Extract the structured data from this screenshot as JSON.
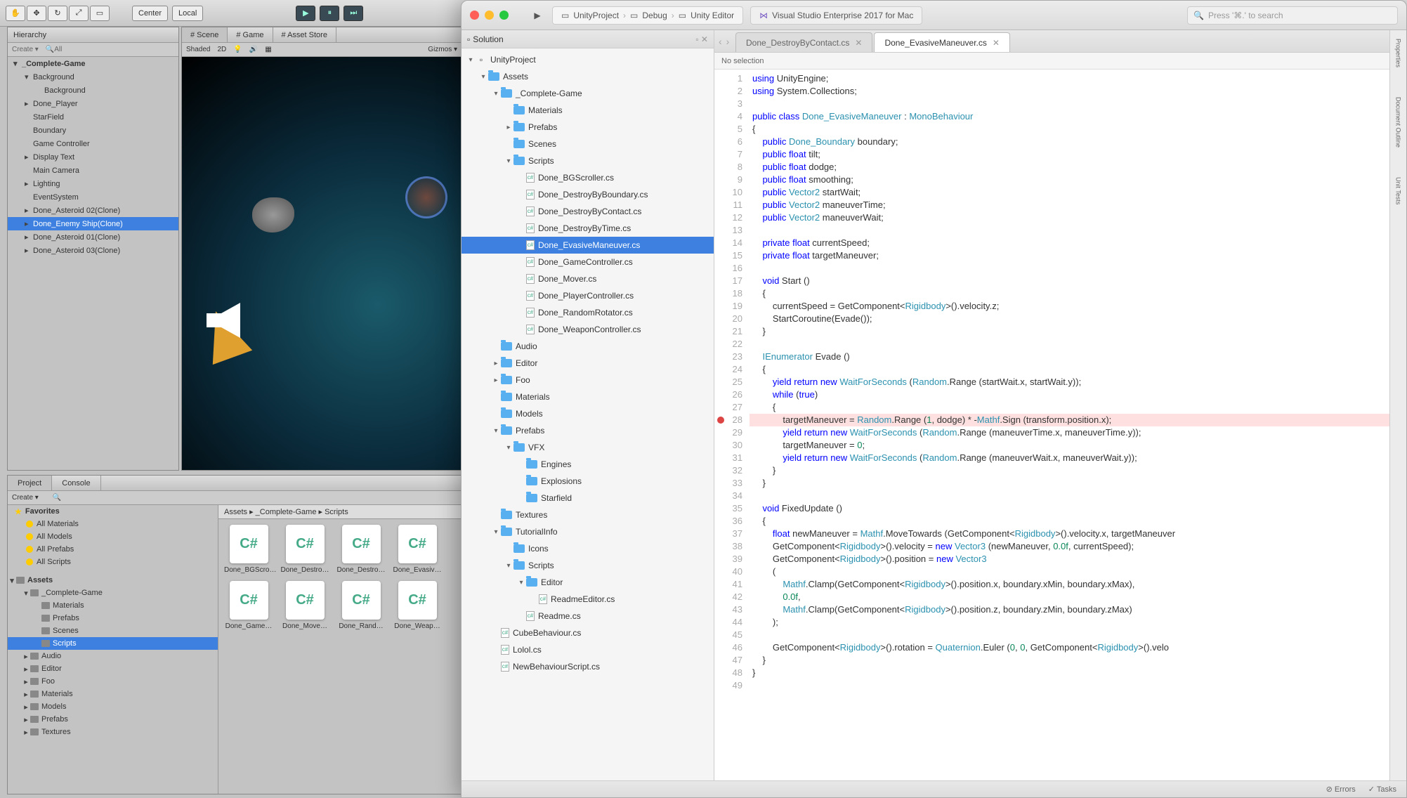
{
  "unity": {
    "toolbarButtons": [
      "✋",
      "✥",
      "↻",
      "⤢",
      "▭"
    ],
    "center": "Center",
    "local": "Local",
    "play": "▶",
    "pause": "⏸",
    "step": "⏭",
    "hierarchyTab": "Hierarchy",
    "create": "Create ▾",
    "searchAll": "All",
    "hierarchy": [
      {
        "label": "_Complete-Game",
        "indent": 0,
        "arrow": "▾",
        "bold": true
      },
      {
        "label": "Background",
        "indent": 1,
        "arrow": "▾"
      },
      {
        "label": "Background",
        "indent": 2
      },
      {
        "label": "Done_Player",
        "indent": 1,
        "arrow": "▸"
      },
      {
        "label": "StarField",
        "indent": 1
      },
      {
        "label": "Boundary",
        "indent": 1
      },
      {
        "label": "Game Controller",
        "indent": 1
      },
      {
        "label": "Display Text",
        "indent": 1,
        "arrow": "▸"
      },
      {
        "label": "Main Camera",
        "indent": 1
      },
      {
        "label": "Lighting",
        "indent": 1,
        "arrow": "▸"
      },
      {
        "label": "EventSystem",
        "indent": 1
      },
      {
        "label": "Done_Asteroid 02(Clone)",
        "indent": 1,
        "arrow": "▸"
      },
      {
        "label": "Done_Enemy Ship(Clone)",
        "indent": 1,
        "arrow": "▸",
        "sel": true
      },
      {
        "label": "Done_Asteroid 01(Clone)",
        "indent": 1,
        "arrow": "▸"
      },
      {
        "label": "Done_Asteroid 03(Clone)",
        "indent": 1,
        "arrow": "▸"
      }
    ],
    "sceneTabs": [
      "Scene",
      "Game",
      "Asset Store"
    ],
    "sceneShaded": "Shaded",
    "scene2D": "2D",
    "sceneGizmos": "Gizmos ▾",
    "projectTab": "Project",
    "consoleTab": "Console",
    "projCreate": "Create ▾",
    "breadcrumb": "Assets ▸ _Complete-Game ▸ Scripts",
    "favorites": {
      "label": "Favorites",
      "items": [
        "All Materials",
        "All Models",
        "All Prefabs",
        "All Scripts"
      ]
    },
    "assetsLabel": "Assets",
    "assetsTree": [
      {
        "label": "_Complete-Game",
        "indent": 1,
        "arrow": "▾"
      },
      {
        "label": "Materials",
        "indent": 2
      },
      {
        "label": "Prefabs",
        "indent": 2
      },
      {
        "label": "Scenes",
        "indent": 2
      },
      {
        "label": "Scripts",
        "indent": 2,
        "sel": true
      },
      {
        "label": "Audio",
        "indent": 1,
        "arrow": "▸"
      },
      {
        "label": "Editor",
        "indent": 1,
        "arrow": "▸"
      },
      {
        "label": "Foo",
        "indent": 1,
        "arrow": "▸"
      },
      {
        "label": "Materials",
        "indent": 1,
        "arrow": "▸"
      },
      {
        "label": "Models",
        "indent": 1,
        "arrow": "▸"
      },
      {
        "label": "Prefabs",
        "indent": 1,
        "arrow": "▸"
      },
      {
        "label": "Textures",
        "indent": 1,
        "arrow": "▸"
      }
    ],
    "gridFiles": [
      "Done_BGScro…",
      "Done_Destro…",
      "Done_Destro…",
      "Done_Evasiv…",
      "Done_Game…",
      "Done_Move…",
      "Done_Rand…",
      "Done_Weap…"
    ]
  },
  "vs": {
    "projectCrumb": {
      "project": "UnityProject",
      "config": "Debug",
      "target": "Unity Editor"
    },
    "appLabel": "Visual Studio Enterprise 2017 for Mac",
    "searchPlaceholder": "Press '⌘.' to search",
    "solutionTitle": "Solution",
    "solutionTree": [
      {
        "label": "UnityProject",
        "indent": 0,
        "arrow": "▾",
        "ico": "sol"
      },
      {
        "label": "Assets",
        "indent": 1,
        "arrow": "▾",
        "ico": "folder"
      },
      {
        "label": "_Complete-Game",
        "indent": 2,
        "arrow": "▾",
        "ico": "folder"
      },
      {
        "label": "Materials",
        "indent": 3,
        "ico": "folder"
      },
      {
        "label": "Prefabs",
        "indent": 3,
        "arrow": "▸",
        "ico": "folder"
      },
      {
        "label": "Scenes",
        "indent": 3,
        "ico": "folder"
      },
      {
        "label": "Scripts",
        "indent": 3,
        "arrow": "▾",
        "ico": "folder"
      },
      {
        "label": "Done_BGScroller.cs",
        "indent": 4,
        "ico": "cs"
      },
      {
        "label": "Done_DestroyByBoundary.cs",
        "indent": 4,
        "ico": "cs"
      },
      {
        "label": "Done_DestroyByContact.cs",
        "indent": 4,
        "ico": "cs"
      },
      {
        "label": "Done_DestroyByTime.cs",
        "indent": 4,
        "ico": "cs"
      },
      {
        "label": "Done_EvasiveManeuver.cs",
        "indent": 4,
        "ico": "cs",
        "sel": true
      },
      {
        "label": "Done_GameController.cs",
        "indent": 4,
        "ico": "cs"
      },
      {
        "label": "Done_Mover.cs",
        "indent": 4,
        "ico": "cs"
      },
      {
        "label": "Done_PlayerController.cs",
        "indent": 4,
        "ico": "cs"
      },
      {
        "label": "Done_RandomRotator.cs",
        "indent": 4,
        "ico": "cs"
      },
      {
        "label": "Done_WeaponController.cs",
        "indent": 4,
        "ico": "cs"
      },
      {
        "label": "Audio",
        "indent": 2,
        "ico": "folder"
      },
      {
        "label": "Editor",
        "indent": 2,
        "arrow": "▸",
        "ico": "folder"
      },
      {
        "label": "Foo",
        "indent": 2,
        "arrow": "▸",
        "ico": "folder"
      },
      {
        "label": "Materials",
        "indent": 2,
        "ico": "folder"
      },
      {
        "label": "Models",
        "indent": 2,
        "ico": "folder"
      },
      {
        "label": "Prefabs",
        "indent": 2,
        "arrow": "▾",
        "ico": "folder"
      },
      {
        "label": "VFX",
        "indent": 3,
        "arrow": "▾",
        "ico": "folder"
      },
      {
        "label": "Engines",
        "indent": 4,
        "ico": "folder"
      },
      {
        "label": "Explosions",
        "indent": 4,
        "ico": "folder"
      },
      {
        "label": "Starfield",
        "indent": 4,
        "ico": "folder"
      },
      {
        "label": "Textures",
        "indent": 2,
        "ico": "folder"
      },
      {
        "label": "TutorialInfo",
        "indent": 2,
        "arrow": "▾",
        "ico": "folder"
      },
      {
        "label": "Icons",
        "indent": 3,
        "ico": "folder"
      },
      {
        "label": "Scripts",
        "indent": 3,
        "arrow": "▾",
        "ico": "folder"
      },
      {
        "label": "Editor",
        "indent": 4,
        "arrow": "▾",
        "ico": "folder"
      },
      {
        "label": "ReadmeEditor.cs",
        "indent": 5,
        "ico": "cs"
      },
      {
        "label": "Readme.cs",
        "indent": 4,
        "ico": "cs"
      },
      {
        "label": "CubeBehaviour.cs",
        "indent": 2,
        "ico": "cs"
      },
      {
        "label": "Lolol.cs",
        "indent": 2,
        "ico": "cs"
      },
      {
        "label": "NewBehaviourScript.cs",
        "indent": 2,
        "ico": "cs"
      }
    ],
    "openTabs": [
      {
        "label": "Done_DestroyByContact.cs",
        "active": false
      },
      {
        "label": "Done_EvasiveManeuver.cs",
        "active": true
      }
    ],
    "subBar": "No selection",
    "rightRail": [
      "Properties",
      "Document Outline",
      "Unit Tests"
    ],
    "statusErrors": "Errors",
    "statusTasks": "Tasks",
    "code": [
      {
        "n": 1,
        "html": "<span class='kw'>using</span> UnityEngine;"
      },
      {
        "n": 2,
        "html": "<span class='kw'>using</span> System.Collections;"
      },
      {
        "n": 3,
        "html": ""
      },
      {
        "n": 4,
        "html": "<span class='kw'>public class</span> <span class='type'>Done_EvasiveManeuver</span> : <span class='type'>MonoBehaviour</span>"
      },
      {
        "n": 5,
        "html": "{"
      },
      {
        "n": 6,
        "html": "    <span class='kw'>public</span> <span class='type'>Done_Boundary</span> boundary;"
      },
      {
        "n": 7,
        "html": "    <span class='kw'>public</span> <span class='kw'>float</span> tilt;"
      },
      {
        "n": 8,
        "html": "    <span class='kw'>public</span> <span class='kw'>float</span> dodge;"
      },
      {
        "n": 9,
        "html": "    <span class='kw'>public</span> <span class='kw'>float</span> smoothing;"
      },
      {
        "n": 10,
        "html": "    <span class='kw'>public</span> <span class='type'>Vector2</span> startWait;"
      },
      {
        "n": 11,
        "html": "    <span class='kw'>public</span> <span class='type'>Vector2</span> maneuverTime;"
      },
      {
        "n": 12,
        "html": "    <span class='kw'>public</span> <span class='type'>Vector2</span> maneuverWait;"
      },
      {
        "n": 13,
        "html": ""
      },
      {
        "n": 14,
        "html": "    <span class='kw'>private</span> <span class='kw'>float</span> currentSpeed;"
      },
      {
        "n": 15,
        "html": "    <span class='kw'>private</span> <span class='kw'>float</span> targetManeuver;"
      },
      {
        "n": 16,
        "html": ""
      },
      {
        "n": 17,
        "html": "    <span class='kw'>void</span> Start ()"
      },
      {
        "n": 18,
        "html": "    {"
      },
      {
        "n": 19,
        "html": "        currentSpeed = GetComponent&lt;<span class='type'>Rigidbody</span>&gt;().velocity.z;"
      },
      {
        "n": 20,
        "html": "        StartCoroutine(Evade());"
      },
      {
        "n": 21,
        "html": "    }"
      },
      {
        "n": 22,
        "html": ""
      },
      {
        "n": 23,
        "html": "    <span class='type'>IEnumerator</span> Evade ()"
      },
      {
        "n": 24,
        "html": "    {"
      },
      {
        "n": 25,
        "html": "        <span class='kw'>yield return new</span> <span class='type'>WaitForSeconds</span> (<span class='type'>Random</span>.Range (startWait.x, startWait.y));"
      },
      {
        "n": 26,
        "html": "        <span class='kw'>while</span> (<span class='kw'>true</span>)"
      },
      {
        "n": 27,
        "html": "        {"
      },
      {
        "n": 28,
        "html": "            targetManeuver = <span class='type'>Random</span>.Range (<span class='num'>1</span>, dodge) * -<span class='type'>Mathf</span>.Sign (transform.position.x);",
        "hl": true,
        "bp": true
      },
      {
        "n": 29,
        "html": "            <span class='kw'>yield return new</span> <span class='type'>WaitForSeconds</span> (<span class='type'>Random</span>.Range (maneuverTime.x, maneuverTime.y));"
      },
      {
        "n": 30,
        "html": "            targetManeuver = <span class='num'>0</span>;"
      },
      {
        "n": 31,
        "html": "            <span class='kw'>yield return new</span> <span class='type'>WaitForSeconds</span> (<span class='type'>Random</span>.Range (maneuverWait.x, maneuverWait.y));"
      },
      {
        "n": 32,
        "html": "        }"
      },
      {
        "n": 33,
        "html": "    }"
      },
      {
        "n": 34,
        "html": ""
      },
      {
        "n": 35,
        "html": "    <span class='kw'>void</span> FixedUpdate ()"
      },
      {
        "n": 36,
        "html": "    {"
      },
      {
        "n": 37,
        "html": "        <span class='kw'>float</span> newManeuver = <span class='type'>Mathf</span>.MoveTowards (GetComponent&lt;<span class='type'>Rigidbody</span>&gt;().velocity.x, targetManeuver"
      },
      {
        "n": 38,
        "html": "        GetComponent&lt;<span class='type'>Rigidbody</span>&gt;().velocity = <span class='kw'>new</span> <span class='type'>Vector3</span> (newManeuver, <span class='num'>0.0f</span>, currentSpeed);"
      },
      {
        "n": 39,
        "html": "        GetComponent&lt;<span class='type'>Rigidbody</span>&gt;().position = <span class='kw'>new</span> <span class='type'>Vector3</span>"
      },
      {
        "n": 40,
        "html": "        ("
      },
      {
        "n": 41,
        "html": "            <span class='type'>Mathf</span>.Clamp(GetComponent&lt;<span class='type'>Rigidbody</span>&gt;().position.x, boundary.xMin, boundary.xMax),"
      },
      {
        "n": 42,
        "html": "            <span class='num'>0.0f</span>,"
      },
      {
        "n": 43,
        "html": "            <span class='type'>Mathf</span>.Clamp(GetComponent&lt;<span class='type'>Rigidbody</span>&gt;().position.z, boundary.zMin, boundary.zMax)"
      },
      {
        "n": 44,
        "html": "        );"
      },
      {
        "n": 45,
        "html": ""
      },
      {
        "n": 46,
        "html": "        GetComponent&lt;<span class='type'>Rigidbody</span>&gt;().rotation = <span class='type'>Quaternion</span>.Euler (<span class='num'>0</span>, <span class='num'>0</span>, GetComponent&lt;<span class='type'>Rigidbody</span>&gt;().velo"
      },
      {
        "n": 47,
        "html": "    }"
      },
      {
        "n": 48,
        "html": "}"
      },
      {
        "n": 49,
        "html": ""
      }
    ]
  }
}
